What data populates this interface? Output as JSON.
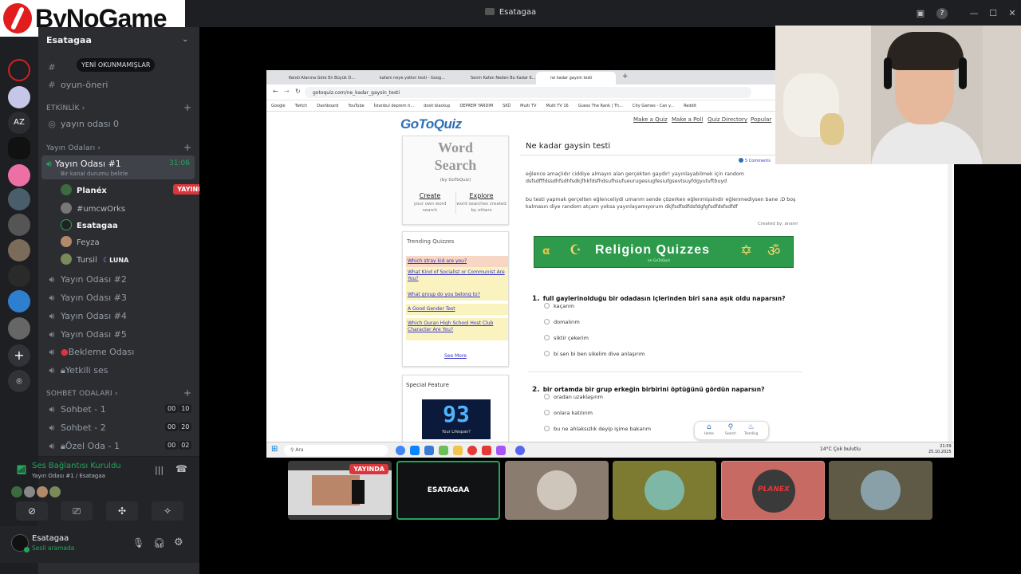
{
  "window": {
    "title": "Esatagaa"
  },
  "logo": {
    "text": "ByNoGame"
  },
  "server": {
    "name": "Esatagaa"
  },
  "tooltip": {
    "unread": "YENİ OKUNMAMIŞLAR"
  },
  "channels_top": [
    {
      "label": "oyun-öneri"
    }
  ],
  "categories": {
    "etkinlik": "ETKİNLİK",
    "yayin": "Yayın Odaları",
    "sohbet": "SOHBET ODALARI"
  },
  "etkinlik_channel": {
    "label": "yayın odası 0"
  },
  "active_room": {
    "label": "Yayın Odası #1",
    "timer": "31:06",
    "status": "Bir kanal durumu belirle"
  },
  "room_users": [
    {
      "name": "Planéx",
      "live": "YAYINDA"
    },
    {
      "name": "#umcwOrks"
    },
    {
      "name": "Esatagaa"
    },
    {
      "name": "Feyza"
    },
    {
      "name": "Tursil",
      "tag": "LUNA"
    }
  ],
  "rooms": [
    {
      "label": "Yayın Odası #2"
    },
    {
      "label": "Yayın Odası #3"
    },
    {
      "label": "Yayın Odası #4"
    },
    {
      "label": "Yayın Odası #5"
    },
    {
      "label": "Bekleme Odası"
    },
    {
      "label": "Yetkili ses"
    }
  ],
  "chat_rooms": [
    {
      "label": "Sohbet - 1",
      "a": "00",
      "b": "10"
    },
    {
      "label": "Sohbet - 2",
      "a": "00",
      "b": "20"
    },
    {
      "label": "Özel Oda - 1",
      "a": "00",
      "b": "02"
    }
  ],
  "voice": {
    "status": "Ses Bağlantısı Kuruldu",
    "location": "Yayın Odası #1 / Esatagaa"
  },
  "me": {
    "name": "Esatagaa",
    "status": "Sesli aramada"
  },
  "browser": {
    "tabs": [
      "Kendi Alanına Göre En Büyük D...",
      "kafam neye yatkın testi - Goog...",
      "Senin Kafan Neden Bu Kadar K...",
      "ne kadar gaysin testi"
    ],
    "url": "gotoquiz.com/ne_kadar_gaysin_testi",
    "bookmarks": [
      "Google",
      "Twitch",
      "Dashboard",
      "YouTube",
      "İstanbul deprem h...",
      "dosit blackup",
      "DEPREM YARDIM",
      "SKÜ",
      "Multi TV",
      "Multi TV 16",
      "Guess The Rank | Th...",
      "City Games - Can y...",
      "Reddit"
    ]
  },
  "site": {
    "logo": "GoToQuiz",
    "nav": [
      "Make a Quiz",
      "Make a Poll",
      "Quiz Directory",
      "Popular"
    ],
    "ws_title_1": "Word",
    "ws_title_2": "Search",
    "ws_by": "(by GoToQuiz)",
    "create": "Create",
    "create_sub": "your own word search",
    "explore": "Explore",
    "explore_sub": "word searches created by others",
    "trending_title": "Trending Quizzes",
    "trending": [
      "Which stray kid are you?",
      "What Kind of Socialist or Communist Are You?",
      "What group do you belong to?",
      "A Good Gender Test",
      "Which Ouran High School Host Club Character Are You?"
    ],
    "see_more": "See More",
    "special": "Special Feature",
    "special_sub": "Your Lifespan?",
    "quiz_title": "Ne kadar gaysin testi",
    "comments": "5 Comments",
    "desc1": "eğlence amaçlıdır ciddiye almayın alan gerçekten gaydir! yayınlayabilmek için random dsfsdfffdssdhfsdhfsdkjfhkfdsfhdsufhsufueurugesiugfesiufgsevtsuyfdgyutvftbuyd",
    "desc2": "bu testi yapmak gerçelten eğlenceliydi umarım sende çözerken eğlenmişsindir eğlenmediysen bane :D boş kalmasın diye random atçam yoksa yayınlayamıyorum dkjfsdfsdfdsfdgfgfsdfdsfsdfdf",
    "created_by": "Created by: anann",
    "banner": "Religion Quizzes",
    "banner_sub": "on GoToQuiz",
    "q1_num": "1.",
    "q1": "full gaylerinolduğu bir odadasın içlerinden biri sana aşık oldu naparsın?",
    "q1_opts": [
      "kaçarım",
      "domalırım",
      "siktir çekerim",
      "bi sen bi ben sikelim dive anlaşırım"
    ],
    "q2_num": "2.",
    "q2": "bir ortamda bir grup erkeğin birbirini öptüğünü gördün naparsın?",
    "q2_opts": [
      "oradan uzaklaşırım",
      "onlara katılırım",
      "bu ne ahlaksızlık deyip işime bakarım"
    ],
    "bottom_nav": [
      "Home",
      "Search",
      "Trending"
    ]
  },
  "taskbar": {
    "search": "Ara",
    "weather": "14°C Çok bulutlu",
    "time": "21:59",
    "date": "25.10.2025"
  },
  "tiles": [
    {
      "label": "",
      "live": "YAYINDA",
      "color": "#3a3a3a"
    },
    {
      "label": "ESATAGAA",
      "color": "#111214"
    },
    {
      "label": "",
      "color": "#8a7c6e"
    },
    {
      "label": "",
      "color": "#7d7a32"
    },
    {
      "label": "PLANEX",
      "color": "#c76a63"
    },
    {
      "label": "",
      "color": "#5e5a46"
    }
  ],
  "colors": {
    "accent_green": "#23a55a",
    "live_red": "#da373c",
    "link_blue": "#3333cc"
  }
}
